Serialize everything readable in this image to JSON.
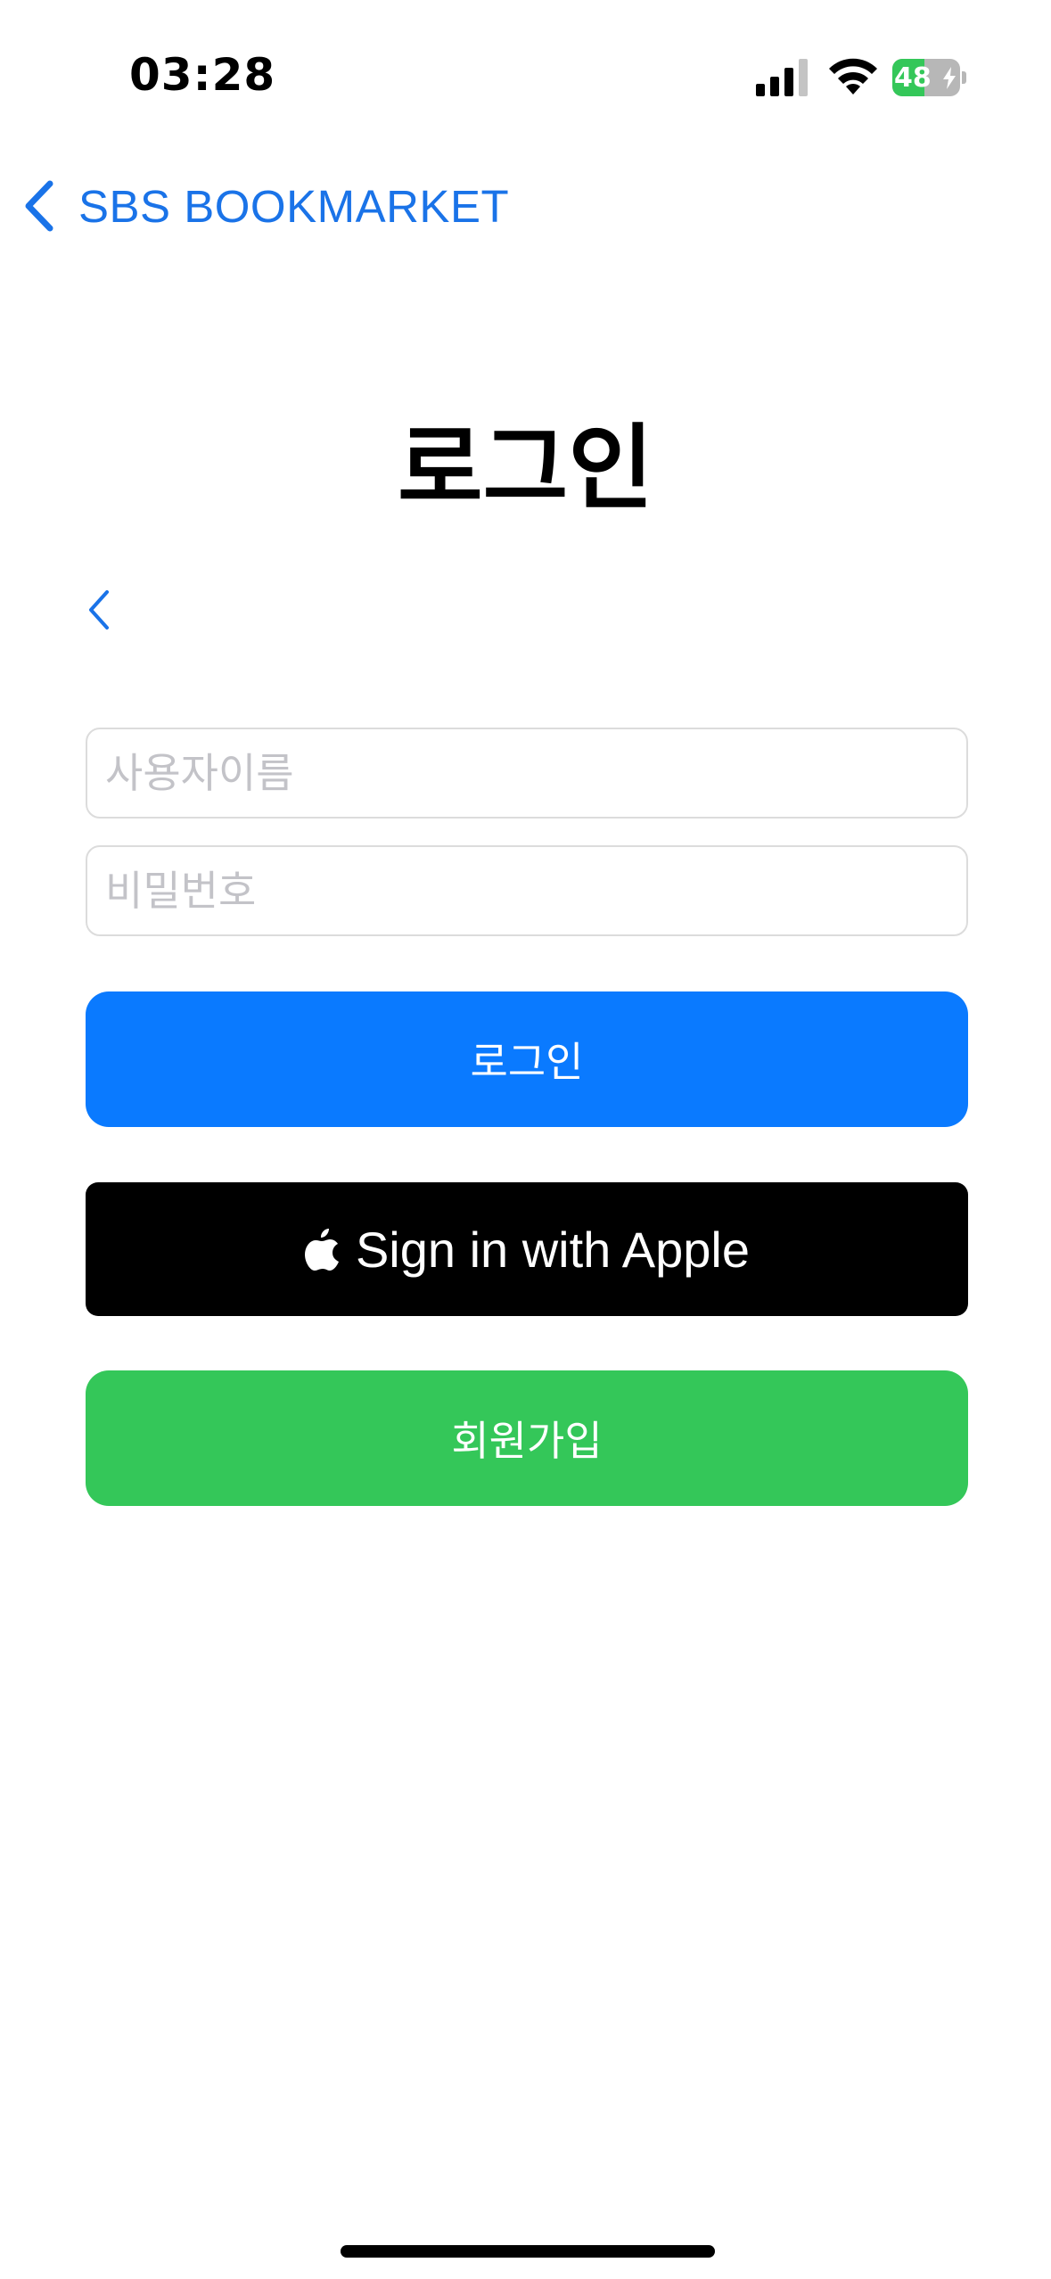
{
  "status_bar": {
    "time": "03:28",
    "battery_percent": "48",
    "battery_level": 0.48,
    "signal_icon": "cellular-signal-icon",
    "wifi_icon": "wifi-icon",
    "battery_icon": "battery-charging-icon"
  },
  "nav": {
    "back_label": "SBS BOOKMARKET",
    "back_icon": "chevron-left-icon"
  },
  "page": {
    "title": "로그인",
    "inner_back_icon": "chevron-left-icon"
  },
  "form": {
    "username_placeholder": "사용자이름",
    "username_value": "",
    "password_placeholder": "비밀번호",
    "password_value": ""
  },
  "buttons": {
    "login_label": "로그인",
    "apple_label": "Sign in with Apple",
    "apple_icon": "apple-logo-icon",
    "signup_label": "회원가입"
  },
  "colors": {
    "accent_blue": "#0a7aff",
    "link_blue": "#1a73e8",
    "apple_black": "#000000",
    "signup_green": "#34c759",
    "placeholder_gray": "#c3c3c8",
    "field_border": "#dcdcdc"
  }
}
